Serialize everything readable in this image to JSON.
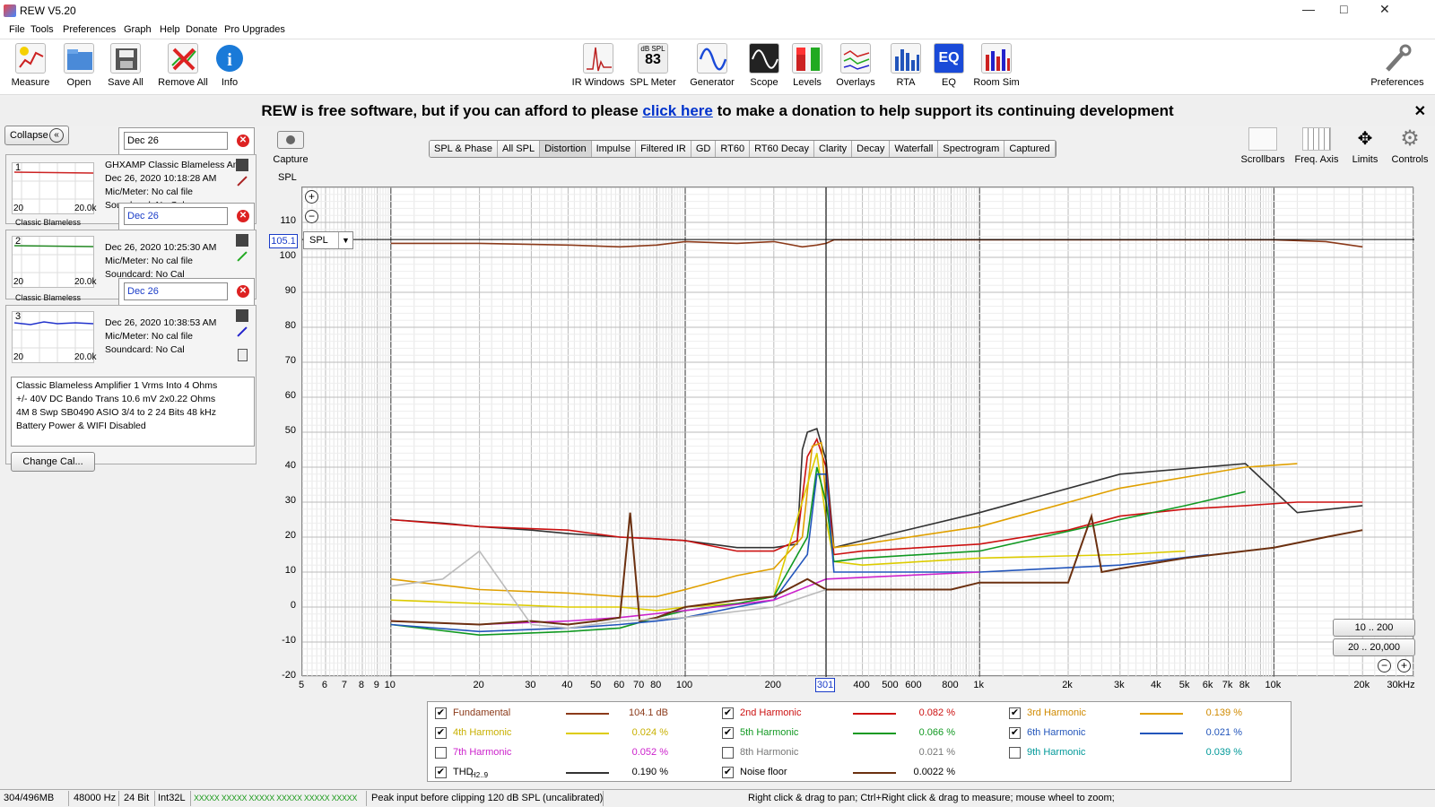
{
  "window": {
    "title": "REW V5.20"
  },
  "menu": [
    "File",
    "Tools",
    "Preferences",
    "Graph",
    "Help",
    "Donate",
    "Pro Upgrades"
  ],
  "toolbar_left": [
    {
      "label": "Measure",
      "icon": "measure-icon"
    },
    {
      "label": "Open",
      "icon": "folder-icon"
    },
    {
      "label": "Save All",
      "icon": "save-icon"
    },
    {
      "label": "Remove All",
      "icon": "remove-icon"
    },
    {
      "label": "Info",
      "icon": "info-icon"
    }
  ],
  "toolbar_center": [
    {
      "label": "IR Windows",
      "icon": "ir-windows-icon"
    },
    {
      "label": "SPL Meter",
      "icon": "spl-meter-icon",
      "badge_top": "dB SPL",
      "badge_value": "83"
    },
    {
      "label": "Generator",
      "icon": "generator-icon"
    },
    {
      "label": "Scope",
      "icon": "scope-icon"
    },
    {
      "label": "Levels",
      "icon": "levels-icon"
    },
    {
      "label": "Overlays",
      "icon": "overlays-icon"
    },
    {
      "label": "RTA",
      "icon": "rta-icon"
    },
    {
      "label": "EQ",
      "icon": "eq-icon"
    },
    {
      "label": "Room Sim",
      "icon": "room-sim-icon"
    }
  ],
  "toolbar_right": {
    "label": "Preferences",
    "icon": "wrench-icon"
  },
  "banner": {
    "pre": "REW is free software, but if you can afford to please ",
    "link": "click here",
    "post": " to make a donation to help support its continuing development"
  },
  "left_panel": {
    "collapse": "Collapse",
    "measurements": [
      {
        "num": "1",
        "filter": "Dec 26",
        "line1": "GHXAMP Classic Blameless Amplifier",
        "line2": "Dec 26, 2020 10:18:28 AM",
        "line3": "Mic/Meter: No cal file",
        "line4": "Soundcard: No Cal",
        "tab": "Classic Blameless",
        "range_lo": "20",
        "range_hi": "20.0k",
        "color": "#cc2222"
      },
      {
        "num": "2",
        "filter": "Dec 26",
        "line1": "",
        "line2": "Dec 26, 2020 10:25:30 AM",
        "line3": "Mic/Meter: No cal file",
        "line4": "Soundcard: No Cal",
        "tab": "Classic Blameless",
        "range_lo": "20",
        "range_hi": "20.0k",
        "color": "#228822"
      },
      {
        "num": "3",
        "filter": "Dec 26",
        "line1": "",
        "line2": "Dec 26, 2020 10:38:53 AM",
        "line3": "Mic/Meter: No cal file",
        "line4": "Soundcard: No Cal",
        "tab": "",
        "range_lo": "20",
        "range_hi": "20.0k",
        "color": "#2233cc"
      }
    ],
    "notes": [
      "Classic Blameless Amplifier 1 Vrms Into 4 Ohms",
      "+/- 40V DC Bando Trans 10.6 mV 2x0.22 Ohms",
      "4M 8 Swp SB0490 ASIO 3/4 to 2 24 Bits 48 kHz",
      "Battery Power & WIFI Disabled"
    ],
    "change_cal": "Change Cal..."
  },
  "capture": "Capture",
  "graph_tabs": [
    {
      "label": "SPL & Phase",
      "selected": false
    },
    {
      "label": "All SPL",
      "selected": false
    },
    {
      "label": "Distortion",
      "selected": true
    },
    {
      "label": "Impulse",
      "selected": false
    },
    {
      "label": "Filtered IR",
      "selected": false
    },
    {
      "label": "GD",
      "selected": false
    },
    {
      "label": "RT60",
      "selected": false
    },
    {
      "label": "RT60 Decay",
      "selected": false
    },
    {
      "label": "Clarity",
      "selected": false
    },
    {
      "label": "Decay",
      "selected": false
    },
    {
      "label": "Waterfall",
      "selected": false
    },
    {
      "label": "Spectrogram",
      "selected": false
    },
    {
      "label": "Captured",
      "selected": false
    }
  ],
  "graph_tools": [
    {
      "label": "Scrollbars",
      "icon": "scrollbars-icon"
    },
    {
      "label": "Freq. Axis",
      "icon": "freq-axis-icon"
    },
    {
      "label": "Limits",
      "icon": "limits-icon"
    },
    {
      "label": "Controls",
      "icon": "controls-icon"
    }
  ],
  "graph": {
    "y_unit": "SPL",
    "cursor_y": "105.1",
    "cursor_x": "301",
    "trace_select": "SPL",
    "zoom1": "10 .. 200",
    "zoom2": "20 .. 20,000"
  },
  "chart_data": {
    "type": "line",
    "ylabel": "SPL",
    "xlabel": "",
    "x_scale": "log",
    "xlim": [
      5,
      30000
    ],
    "ylim": [
      -20,
      120
    ],
    "y_ticks": [
      "110",
      "100",
      "90",
      "80",
      "70",
      "60",
      "50",
      "40",
      "30",
      "20",
      "10",
      "0",
      "-10",
      "-20"
    ],
    "x_ticks": [
      "5",
      "6",
      "7",
      "8",
      "9",
      "10",
      "20",
      "30",
      "40",
      "50",
      "60",
      "70",
      "80",
      "100",
      "200",
      "300",
      "400",
      "500",
      "600",
      "800",
      "1k",
      "2k",
      "3k",
      "4k",
      "5k",
      "6k",
      "7k",
      "8k",
      "10k",
      "20k",
      "30kHz"
    ],
    "cursor": {
      "x": 301,
      "y": 105.1
    },
    "series": [
      {
        "name": "Fundamental",
        "color": "#8b3a1a",
        "x": [
          10,
          20,
          40,
          60,
          80,
          100,
          150,
          200,
          250,
          280,
          301,
          320,
          500,
          1000,
          5000,
          10000,
          15000,
          20000
        ],
        "y": [
          104,
          104,
          103.5,
          103,
          103.5,
          104.5,
          104,
          104.5,
          103,
          103.5,
          104,
          105,
          105,
          105,
          105,
          105,
          104.5,
          103
        ]
      },
      {
        "name": "THD",
        "color": "#333333",
        "x": [
          10,
          15,
          20,
          30,
          40,
          60,
          80,
          100,
          150,
          200,
          240,
          250,
          260,
          280,
          301,
          320,
          400,
          1000,
          3000,
          8000,
          12000,
          20000
        ],
        "y": [
          25,
          24,
          23,
          22,
          21,
          20,
          19.5,
          19,
          17,
          17,
          18,
          45,
          50,
          51,
          42,
          17,
          19,
          27,
          38,
          41,
          27,
          29
        ]
      },
      {
        "name": "2nd Harmonic",
        "color": "#cc1111",
        "x": [
          10,
          20,
          40,
          60,
          80,
          100,
          150,
          200,
          240,
          260,
          280,
          301,
          320,
          400,
          1000,
          2000,
          3000,
          5000,
          8000,
          12000,
          20000
        ],
        "y": [
          25,
          23,
          22,
          20,
          19.5,
          19,
          16,
          16,
          19,
          43,
          48,
          40,
          15,
          16,
          18,
          22,
          26,
          28,
          29,
          30,
          30
        ]
      },
      {
        "name": "3rd Harmonic",
        "color": "#e0a000",
        "x": [
          10,
          20,
          40,
          60,
          80,
          100,
          150,
          200,
          250,
          270,
          290,
          301,
          320,
          400,
          1000,
          3000,
          8000,
          12000
        ],
        "y": [
          8,
          5,
          4,
          3,
          3,
          5,
          9,
          11,
          20,
          46,
          47,
          30,
          17,
          18,
          23,
          34,
          40,
          41
        ]
      },
      {
        "name": "4th Harmonic",
        "color": "#ddcc00",
        "x": [
          10,
          20,
          40,
          60,
          80,
          100,
          150,
          200,
          260,
          280,
          301,
          320,
          400,
          1000,
          3000,
          5000
        ],
        "y": [
          2,
          1,
          0,
          0,
          -1,
          0,
          1,
          3,
          35,
          44,
          25,
          13,
          12,
          14,
          15,
          16
        ]
      },
      {
        "name": "5th Harmonic",
        "color": "#119922",
        "x": [
          10,
          20,
          40,
          60,
          80,
          100,
          150,
          200,
          260,
          280,
          301,
          320,
          400,
          1000,
          3000,
          5000,
          8000
        ],
        "y": [
          -5,
          -8,
          -7,
          -6,
          -3,
          -1,
          1,
          3,
          20,
          40,
          30,
          13,
          14,
          16,
          25,
          29,
          33
        ]
      },
      {
        "name": "6th Harmonic",
        "color": "#2255bb",
        "x": [
          10,
          20,
          40,
          60,
          80,
          100,
          150,
          200,
          260,
          280,
          301,
          320,
          1000,
          3000,
          6000
        ],
        "y": [
          -5,
          -7,
          -6,
          -5,
          -4,
          -3,
          0,
          2,
          15,
          38,
          38,
          10,
          10,
          12,
          15
        ]
      },
      {
        "name": "7th Harmonic",
        "color": "#cc22cc",
        "x": [
          10,
          20,
          40,
          60,
          100,
          200,
          301,
          1000
        ],
        "y": [
          -4,
          -5,
          -4,
          -3,
          -1,
          2,
          8,
          10
        ]
      },
      {
        "name": "Noise floor",
        "color": "#6b3010",
        "x": [
          10,
          20,
          30,
          40,
          50,
          60,
          65,
          70,
          80,
          100,
          150,
          200,
          260,
          301,
          400,
          800,
          1000,
          2000,
          2400,
          2600,
          3000,
          5000,
          10000,
          15000,
          20000
        ],
        "y": [
          -4,
          -5,
          -4,
          -5,
          -4,
          -3,
          27,
          -4,
          -3,
          0,
          2,
          3,
          8,
          5,
          5,
          5,
          7,
          7,
          26,
          10,
          11,
          14,
          17,
          20,
          22
        ]
      },
      {
        "name": "8th Harmonic",
        "color": "#bbbbbb",
        "x": [
          10,
          15,
          20,
          30,
          40,
          60,
          100,
          200,
          301
        ],
        "y": [
          6,
          8,
          16,
          -5,
          -6,
          -4,
          -3,
          0,
          5
        ]
      }
    ]
  },
  "legend": [
    {
      "name": "Fundamental",
      "checked": true,
      "value": "104.1 dB",
      "color": "#8b3a1a",
      "textcolor": "#8b3a1a"
    },
    {
      "name": "2nd Harmonic",
      "checked": true,
      "value": "0.082 %",
      "color": "#cc1111",
      "textcolor": "#cc1111"
    },
    {
      "name": "3rd Harmonic",
      "checked": true,
      "value": "0.139 %",
      "color": "#e0a000",
      "textcolor": "#d08a00"
    },
    {
      "name": "4th Harmonic",
      "checked": true,
      "value": "0.024 %",
      "color": "#ddcc00",
      "textcolor": "#c8b000"
    },
    {
      "name": "5th Harmonic",
      "checked": true,
      "value": "0.066 %",
      "color": "#119922",
      "textcolor": "#119922"
    },
    {
      "name": "6th Harmonic",
      "checked": true,
      "value": "0.021 %",
      "color": "#2255bb",
      "textcolor": "#2255bb"
    },
    {
      "name": "7th Harmonic",
      "checked": false,
      "value": "0.052 %",
      "color": "",
      "textcolor": "#cc22cc"
    },
    {
      "name": "8th Harmonic",
      "checked": false,
      "value": "0.021 %",
      "color": "",
      "textcolor": "#777777"
    },
    {
      "name": "9th Harmonic",
      "checked": false,
      "value": "0.039 %",
      "color": "",
      "textcolor": "#009999"
    },
    {
      "name": "THD",
      "sub": "H2..9",
      "checked": true,
      "value": "0.190 %",
      "color": "#333333",
      "textcolor": "#000000"
    },
    {
      "name": "Noise floor",
      "checked": true,
      "value": "0.0022 %",
      "color": "#6b3010",
      "textcolor": "#000000"
    }
  ],
  "status": {
    "memory": "304/496MB",
    "rate": "48000 Hz",
    "bits": "24 Bit",
    "fmt": "Int32L",
    "meter": "XXXXX XXXXX  XXXXX XXXXX  XXXXX XXXXX",
    "peak": "Peak input before clipping 120 dB SPL (uncalibrated)",
    "hint": "Right click & drag to pan; Ctrl+Right click & drag to measure; mouse wheel to zoom;"
  }
}
